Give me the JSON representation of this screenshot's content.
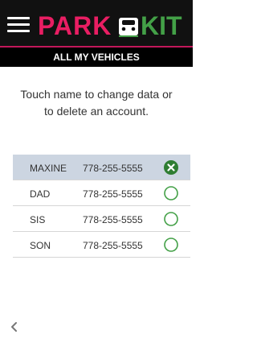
{
  "brand": {
    "name": "PARKKIT",
    "primary_color": "#e91e63",
    "accent_color": "#43a047"
  },
  "header": {
    "menu_icon": "hamburger-icon",
    "subtitle": "ALL MY VEHICLES"
  },
  "instruction": "Touch name to change data or to delete an account.",
  "vehicles": [
    {
      "name": "MAXINE",
      "phone": "778-255-5555",
      "selected": true,
      "status_icon": "close-circle-icon"
    },
    {
      "name": "DAD",
      "phone": "778-255-5555",
      "selected": false,
      "status_icon": "circle-outline-icon"
    },
    {
      "name": "SIS",
      "phone": "778-255-5555",
      "selected": false,
      "status_icon": "circle-outline-icon"
    },
    {
      "name": "SON",
      "phone": "778-255-5555",
      "selected": false,
      "status_icon": "circle-outline-icon"
    }
  ],
  "footer": {
    "back_icon": "chevron-left-icon"
  }
}
